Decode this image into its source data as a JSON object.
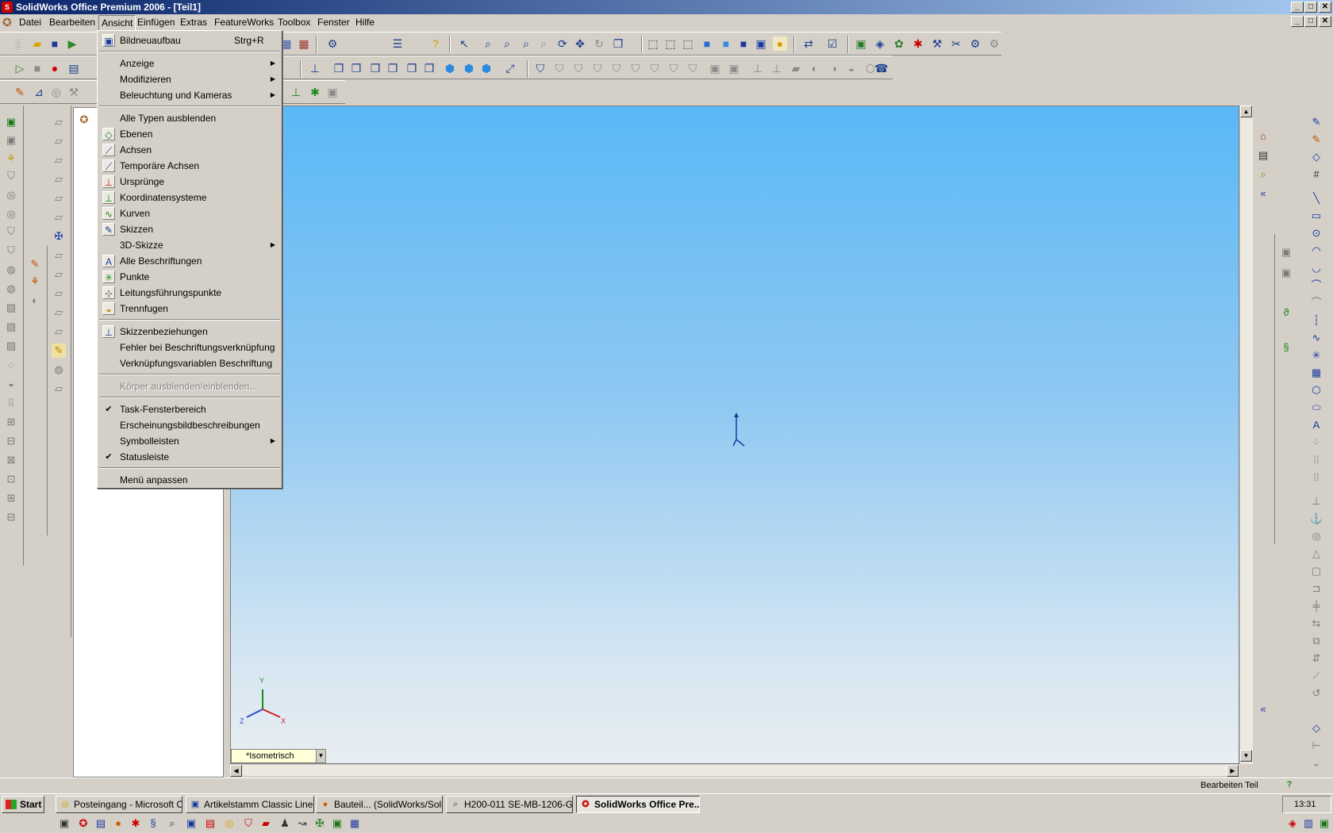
{
  "window": {
    "title": "SolidWorks Office Premium 2006 - [Teil1]",
    "controls": [
      "_",
      "□",
      "✕"
    ]
  },
  "menubar": {
    "items": [
      "Datei",
      "Bearbeiten",
      "Ansicht",
      "Einfügen",
      "Extras",
      "FeatureWorks",
      "Toolbox",
      "Fenster",
      "Hilfe"
    ],
    "active": "Ansicht"
  },
  "dropdown": {
    "items": [
      {
        "label": "Bildneuaufbau",
        "shortcut": "Strg+R",
        "icon": "redraw-icon"
      },
      {
        "label": "Anzeige",
        "submenu": true
      },
      {
        "label": "Modifizieren",
        "submenu": true
      },
      {
        "label": "Beleuchtung und Kameras",
        "submenu": true
      },
      {
        "label": "Alle Typen ausblenden"
      },
      {
        "label": "Ebenen",
        "icon": "planes-icon"
      },
      {
        "label": "Achsen",
        "icon": "axes-icon"
      },
      {
        "label": "Temporäre Achsen",
        "icon": "temp-axes-icon"
      },
      {
        "label": "Ursprünge",
        "icon": "origins-icon"
      },
      {
        "label": "Koordinatensysteme",
        "icon": "coordinate-systems-icon"
      },
      {
        "label": "Kurven",
        "icon": "curves-icon"
      },
      {
        "label": "Skizzen",
        "icon": "sketches-icon"
      },
      {
        "label": "3D-Skizze",
        "submenu": true
      },
      {
        "label": "Alle Beschriftungen",
        "icon": "annotations-icon"
      },
      {
        "label": "Punkte",
        "icon": "points-icon"
      },
      {
        "label": "Leitungsführungspunkte",
        "icon": "routing-points-icon"
      },
      {
        "label": "Trennfugen",
        "icon": "parting-lines-icon"
      },
      {
        "label": "Skizzenbeziehungen",
        "icon": "sketch-relations-icon"
      },
      {
        "label": "Fehler bei Beschriftungsverknüpfung"
      },
      {
        "label": "Verknüpfungsvariablen Beschriftung"
      },
      {
        "label": "Körper ausblenden/einblenden...",
        "disabled": true
      },
      {
        "label": "Task-Fensterbereich",
        "checked": true
      },
      {
        "label": "Erscheinungsbildbeschreibungen"
      },
      {
        "label": "Symbolleisten",
        "submenu": true
      },
      {
        "label": "Statusleiste",
        "checked": true
      },
      {
        "label": "Menü anpassen"
      }
    ]
  },
  "viewport": {
    "view_orientation": "*Isometrisch",
    "triad_labels": {
      "x": "X",
      "y": "Y",
      "z": "Z"
    },
    "gradient_top": "#5ab8f6",
    "gradient_bottom": "#e8eef2"
  },
  "statusbar": {
    "text": "Bearbeiten Teil"
  },
  "taskbar": {
    "start_label": "Start",
    "buttons": [
      {
        "label": "Posteingang - Microsoft O...",
        "icon": "outlook-icon"
      },
      {
        "label": "Artikelstamm  Classic Line ...",
        "icon": "app-window-icon"
      },
      {
        "label": "Bauteil... (SolidWorks/Soli...",
        "icon": "firefox-icon"
      },
      {
        "label": "H200-011 SE-MB-1206-G...",
        "icon": "viewer-icon"
      },
      {
        "label": "SolidWorks Office Pre...",
        "icon": "solidworks-icon",
        "active": true
      }
    ],
    "clock": "13:31"
  },
  "colors": {
    "titlebar_start": "#0a246a",
    "titlebar_end": "#a6caf0",
    "face": "#d4d0c8"
  }
}
